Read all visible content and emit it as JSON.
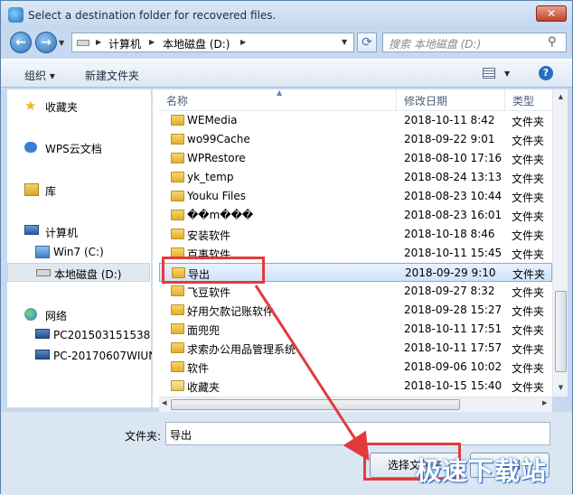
{
  "window": {
    "title": "Select a destination folder for recovered files.",
    "close_label": "✕"
  },
  "nav": {
    "back": "←",
    "forward": "→",
    "address": [
      "计算机",
      "本地磁盘 (D:)"
    ],
    "search_placeholder": "搜索 本地磁盘 (D:)"
  },
  "toolbar": {
    "organize": "组织 ▾",
    "new_folder": "新建文件夹"
  },
  "sidebar": {
    "items": [
      {
        "label": "收藏夹",
        "icon": "star-icon"
      },
      {
        "label": "WPS云文档",
        "icon": "cloud-icon"
      },
      {
        "label": "库",
        "icon": "library-icon"
      },
      {
        "label": "计算机",
        "icon": "computer-icon"
      },
      {
        "label": "Win7 (C:)",
        "icon": "drive-c-icon"
      },
      {
        "label": "本地磁盘 (D:)",
        "icon": "drive-d-icon"
      },
      {
        "label": "网络",
        "icon": "network-icon"
      },
      {
        "label": "PC201503151538",
        "icon": "pc-icon"
      },
      {
        "label": "PC-20170607WIUN",
        "icon": "pc-icon"
      }
    ]
  },
  "columns": {
    "name": "名称",
    "date": "修改日期",
    "type": "类型"
  },
  "files": [
    {
      "name": "WEMedia",
      "date": "2018-10-11 8:42",
      "type": "文件夹"
    },
    {
      "name": "wo99Cache",
      "date": "2018-09-22 9:01",
      "type": "文件夹"
    },
    {
      "name": "WPRestore",
      "date": "2018-08-10 17:16",
      "type": "文件夹"
    },
    {
      "name": "yk_temp",
      "date": "2018-08-24 13:13",
      "type": "文件夹"
    },
    {
      "name": "Youku Files",
      "date": "2018-08-23 10:44",
      "type": "文件夹"
    },
    {
      "name": "��m���",
      "date": "2018-08-23 16:01",
      "type": "文件夹"
    },
    {
      "name": "安装软件",
      "date": "2018-10-18 8:46",
      "type": "文件夹"
    },
    {
      "name": "百事软件",
      "date": "2018-10-11 15:45",
      "type": "文件夹"
    },
    {
      "name": "导出",
      "date": "2018-09-29 9:10",
      "type": "文件夹"
    },
    {
      "name": "飞豆软件",
      "date": "2018-09-27 8:32",
      "type": "文件夹"
    },
    {
      "name": "好用欠款记账软件",
      "date": "2018-09-28 15:27",
      "type": "文件夹"
    },
    {
      "name": "面兜兜",
      "date": "2018-10-11 17:51",
      "type": "文件夹"
    },
    {
      "name": "求索办公用品管理系统",
      "date": "2018-10-11 17:57",
      "type": "文件夹"
    },
    {
      "name": "软件",
      "date": "2018-09-06 10:02",
      "type": "文件夹"
    },
    {
      "name": "收藏夹",
      "date": "2018-10-15 15:40",
      "type": "文件夹"
    }
  ],
  "selected_index": 8,
  "bottom": {
    "folder_label": "文件夹:",
    "folder_value": "导出",
    "select_button": "选择文件夹",
    "cancel_button": "取消"
  },
  "watermark": "极速下载站",
  "colors": {
    "highlight": "#e23b3b",
    "selection": "#cfe3fb"
  }
}
